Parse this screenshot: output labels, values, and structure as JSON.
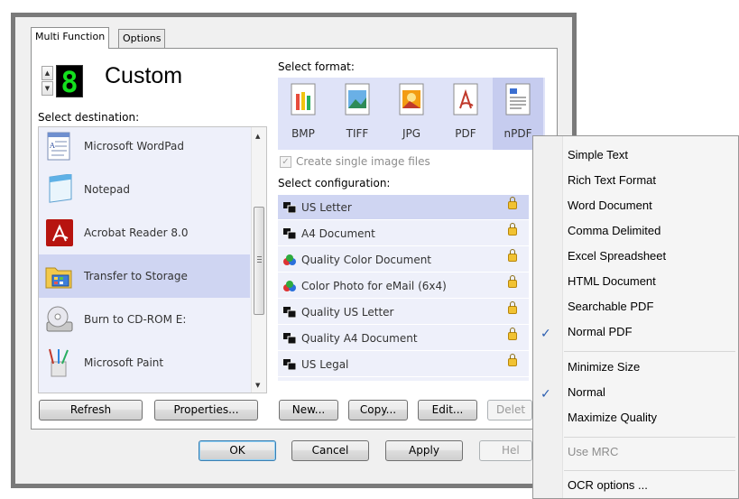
{
  "tabs": [
    {
      "label": "Multi Function",
      "active": true
    },
    {
      "label": "Options",
      "active": false
    }
  ],
  "profile": {
    "digit": "8",
    "name": "Custom",
    "digit_color": "#14e01e"
  },
  "destination": {
    "label": "Select destination:",
    "items": [
      {
        "label": "Microsoft WordPad",
        "icon": "wordpad-icon",
        "selected": false
      },
      {
        "label": "Notepad",
        "icon": "notepad-icon",
        "selected": false
      },
      {
        "label": "Acrobat Reader 8.0",
        "icon": "acrobat-icon",
        "selected": false
      },
      {
        "label": "Transfer to Storage",
        "icon": "folder-storage-icon",
        "selected": true
      },
      {
        "label": "Burn to CD-ROM  E:",
        "icon": "cd-burn-icon",
        "selected": false
      },
      {
        "label": "Microsoft Paint",
        "icon": "paint-icon",
        "selected": false
      }
    ],
    "refresh_label": "Refresh",
    "properties_label": "Properties..."
  },
  "format": {
    "label": "Select format:",
    "items": [
      {
        "label": "BMP",
        "icon": "bmp-icon",
        "selected": false
      },
      {
        "label": "TIFF",
        "icon": "tiff-icon",
        "selected": false
      },
      {
        "label": "JPG",
        "icon": "jpg-icon",
        "selected": false
      },
      {
        "label": "PDF",
        "icon": "pdf-icon",
        "selected": false
      },
      {
        "label": "nPDF",
        "icon": "npdf-icon",
        "selected": true
      }
    ],
    "single_image_label": "Create single image files",
    "single_image_checked": true
  },
  "configuration": {
    "label": "Select configuration:",
    "items": [
      {
        "label": "US Letter",
        "icon": "bw-scan-icon",
        "selected": true
      },
      {
        "label": "A4 Document",
        "icon": "bw-scan-icon",
        "selected": false
      },
      {
        "label": "Quality Color Document",
        "icon": "color-scan-icon",
        "selected": false
      },
      {
        "label": "Color Photo for eMail (6x4)",
        "icon": "color-scan-icon",
        "selected": false
      },
      {
        "label": "Quality US Letter",
        "icon": "bw-scan-icon",
        "selected": false
      },
      {
        "label": "Quality A4 Document",
        "icon": "bw-scan-icon",
        "selected": false
      },
      {
        "label": "US Legal",
        "icon": "bw-scan-icon",
        "selected": false
      }
    ],
    "new_label": "New...",
    "copy_label": "Copy...",
    "edit_label": "Edit...",
    "delete_label": "Delet"
  },
  "dialog_buttons": {
    "ok_label": "OK",
    "cancel_label": "Cancel",
    "apply_label": "Apply",
    "help_label": "Hel"
  },
  "context_menu": {
    "groups": [
      [
        {
          "label": "Simple Text",
          "checked": false,
          "disabled": false
        },
        {
          "label": "Rich Text Format",
          "checked": false,
          "disabled": false
        },
        {
          "label": "Word Document",
          "checked": false,
          "disabled": false
        },
        {
          "label": "Comma Delimited",
          "checked": false,
          "disabled": false
        },
        {
          "label": "Excel Spreadsheet",
          "checked": false,
          "disabled": false
        },
        {
          "label": "HTML Document",
          "checked": false,
          "disabled": false
        },
        {
          "label": "Searchable PDF",
          "checked": false,
          "disabled": false
        },
        {
          "label": "Normal PDF",
          "checked": true,
          "disabled": false
        }
      ],
      [
        {
          "label": "Minimize Size",
          "checked": false,
          "disabled": false
        },
        {
          "label": "Normal",
          "checked": true,
          "disabled": false
        },
        {
          "label": "Maximize Quality",
          "checked": false,
          "disabled": false
        }
      ],
      [
        {
          "label": "Use MRC",
          "checked": false,
          "disabled": true
        }
      ],
      [
        {
          "label": "OCR options ...",
          "checked": false,
          "disabled": false
        }
      ]
    ],
    "check_glyph": "✓"
  }
}
